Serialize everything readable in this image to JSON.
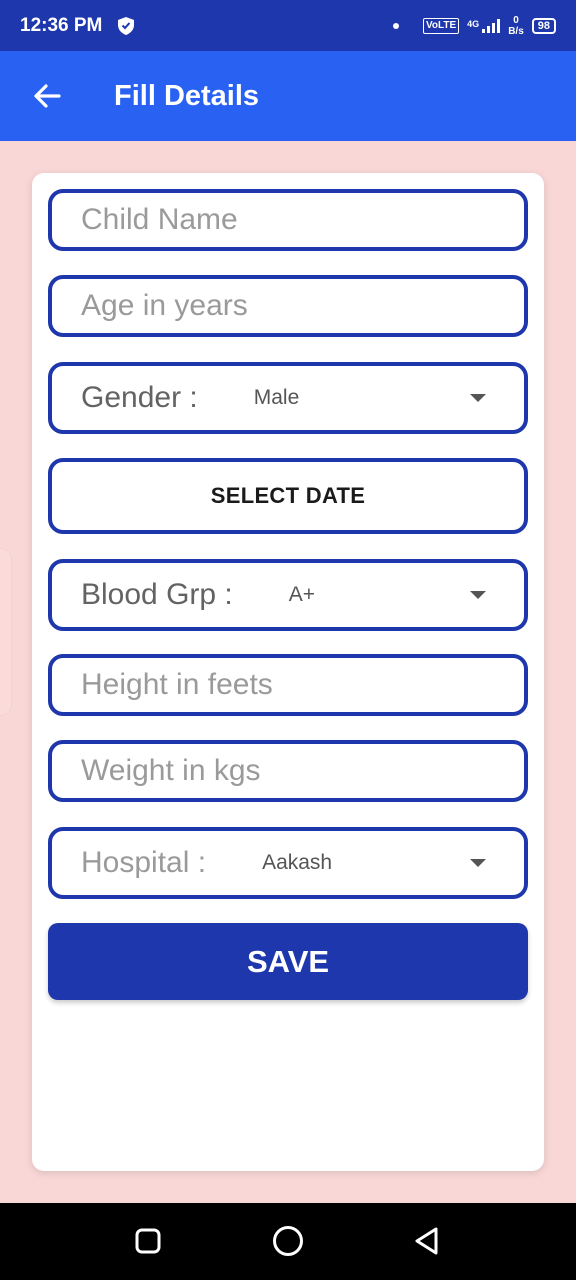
{
  "status_bar": {
    "time": "12:36 PM",
    "volte": "VoLTE",
    "network": "4G",
    "speed_value": "0",
    "speed_unit": "B/s",
    "battery": "98"
  },
  "app_bar": {
    "back_icon": "arrow-left-icon",
    "title": "Fill Details"
  },
  "form": {
    "child_name_placeholder": "Child Name",
    "age_placeholder": "Age in years",
    "gender": {
      "label": "Gender :",
      "value": "Male"
    },
    "select_date_label": "SELECT DATE",
    "blood_group": {
      "label": "Blood Grp :",
      "value": "A+"
    },
    "height_placeholder": "Height in feets",
    "weight_placeholder": "Weight in kgs",
    "hospital": {
      "label": "Hospital :",
      "value": "Aakash"
    },
    "save_label": "SAVE"
  },
  "nav_bar": {
    "recents_icon": "square-icon",
    "home_icon": "circle-icon",
    "back_icon": "triangle-back-icon"
  },
  "colors": {
    "primary_dark": "#1e37ac",
    "app_bar": "#2962f2",
    "background": "#f8d7d6"
  }
}
